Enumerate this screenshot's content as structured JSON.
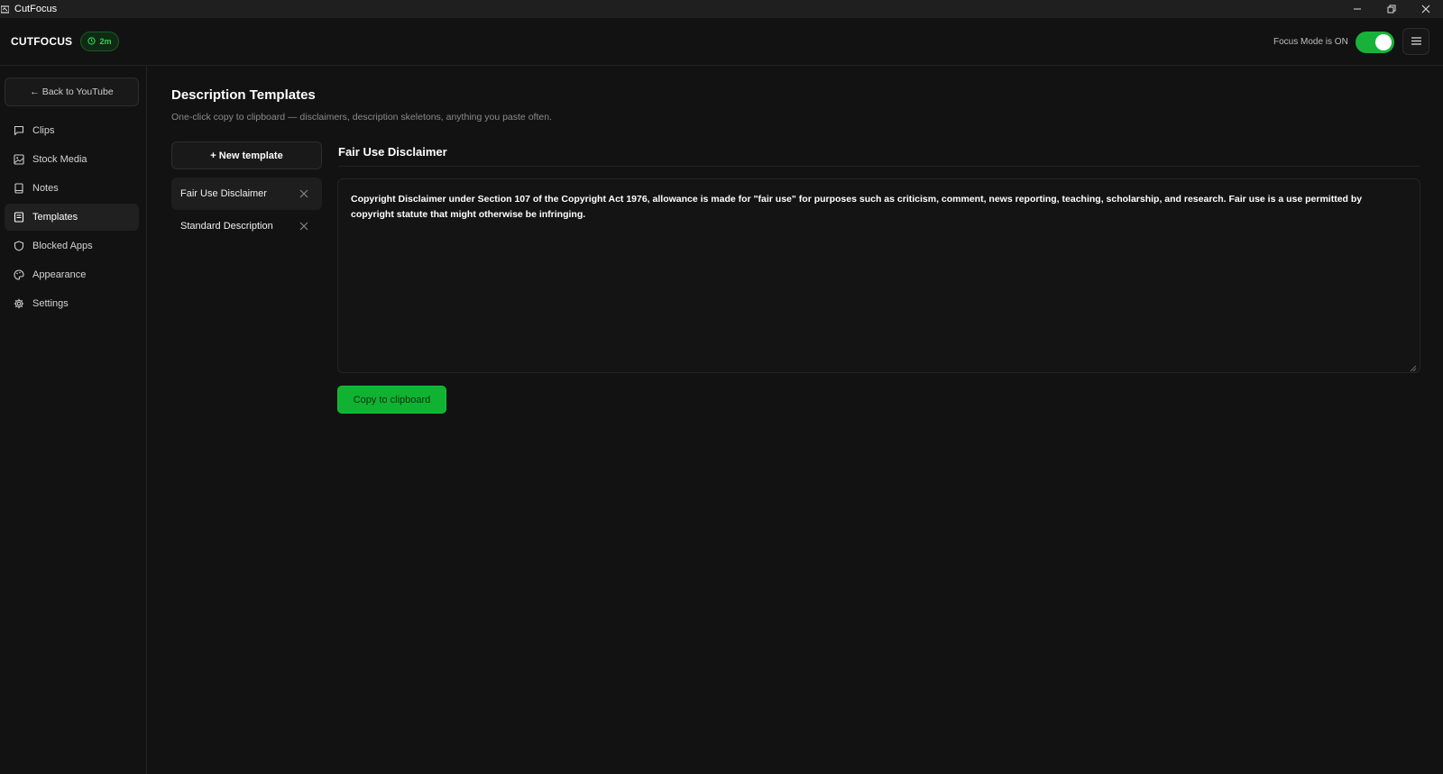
{
  "window": {
    "title": "CutFocus",
    "controls": [
      "minimize-icon",
      "restore-icon",
      "close-icon"
    ]
  },
  "header": {
    "logo": "CUTFOCUS",
    "timer_badge": "2m",
    "focus_label": "Focus Mode is ON",
    "focus_on": true,
    "accent_color": "#18b23a"
  },
  "sidebar": {
    "back_label": "← Back to YouTube",
    "items": [
      {
        "label": "Clips",
        "icon": "chat-bubble-icon"
      },
      {
        "label": "Stock Media",
        "icon": "image-icon"
      },
      {
        "label": "Notes",
        "icon": "notebook-icon"
      },
      {
        "label": "Templates",
        "icon": "template-icon",
        "active": true
      },
      {
        "label": "Blocked Apps",
        "icon": "shield-icon"
      },
      {
        "label": "Appearance",
        "icon": "palette-icon"
      },
      {
        "label": "Settings",
        "icon": "gear-icon"
      }
    ]
  },
  "main": {
    "title": "Description Templates",
    "subtitle": "One-click copy to clipboard — disclaimers, description skeletons, anything you paste often.",
    "new_template_label": "+ New template",
    "templates": [
      {
        "name": "Fair Use Disclaimer",
        "active": true
      },
      {
        "name": "Standard Description",
        "active": false
      }
    ],
    "editor": {
      "title": "Fair Use Disclaimer",
      "content": "Copyright Disclaimer under Section 107 of the Copyright Act 1976, allowance is made for \"fair use\" for purposes such as criticism, comment, news reporting, teaching, scholarship, and research. Fair use is a use permitted by copyright statute that might otherwise be infringing."
    },
    "copy_label": "Copy to clipboard"
  }
}
